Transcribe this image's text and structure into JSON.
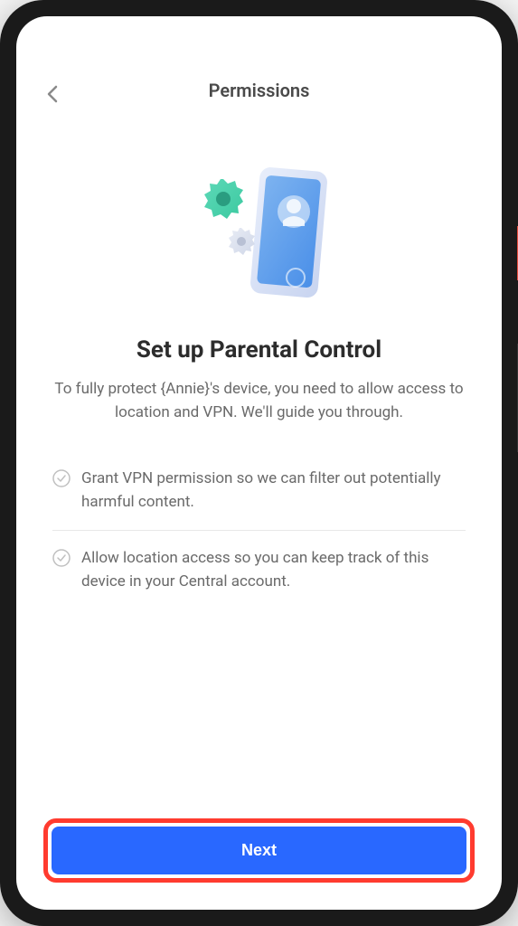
{
  "header": {
    "title": "Permissions"
  },
  "main": {
    "title": "Set up Parental Control",
    "description": "To fully protect {Annie}'s device, you need to allow access to location and VPN. We'll guide you through."
  },
  "permissions": [
    {
      "text": "Grant VPN permission so we can filter out potentially harmful content."
    },
    {
      "text": "Allow location access so you can keep track of this device in your Central account."
    }
  ],
  "footer": {
    "next_label": "Next"
  }
}
